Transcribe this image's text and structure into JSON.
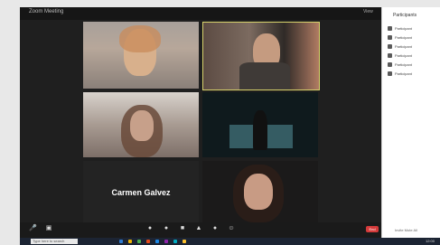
{
  "window": {
    "title": "Zoom Meeting",
    "top_right": "View"
  },
  "tiles": [
    {
      "name": "",
      "id": "t1"
    },
    {
      "name": "",
      "id": "t2"
    },
    {
      "name": "",
      "id": "t3"
    },
    {
      "name": "",
      "id": "t4"
    },
    {
      "name": "Carmen Galvez",
      "id": "t5"
    },
    {
      "name": "",
      "id": "t6"
    }
  ],
  "sidebar": {
    "title": "Participants",
    "items": [
      "Participant",
      "Participant",
      "Participant",
      "Participant",
      "Participant",
      "Participant"
    ],
    "bottom": "Invite   Mute All"
  },
  "toolbar": {
    "leave_label": "End"
  },
  "taskbar": {
    "search_placeholder": "Type here to search",
    "clock": "12:00"
  }
}
